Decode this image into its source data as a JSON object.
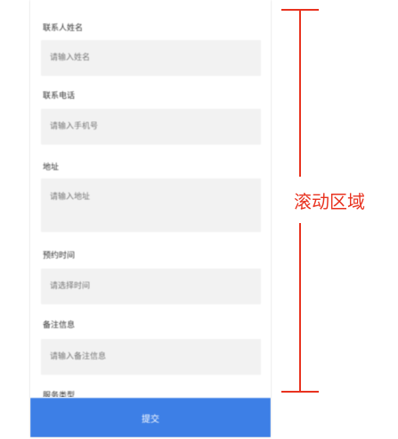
{
  "form": {
    "fields": [
      {
        "label": "联系人姓名",
        "placeholder": "请输入姓名"
      },
      {
        "label": "联系电话",
        "placeholder": "请输入手机号"
      },
      {
        "label": "地址",
        "placeholder": "请输入地址"
      },
      {
        "label": "预约时间",
        "placeholder": "请选择时间"
      },
      {
        "label": "备注信息",
        "placeholder": "请输入备注信息"
      }
    ],
    "partial_label": "服务类型"
  },
  "submit_label": "提交",
  "annotation": {
    "text": "滚动区域",
    "color": "#e8321f"
  },
  "colors": {
    "primary": "#3d7fe6",
    "input_bg": "#f2f2f2"
  }
}
